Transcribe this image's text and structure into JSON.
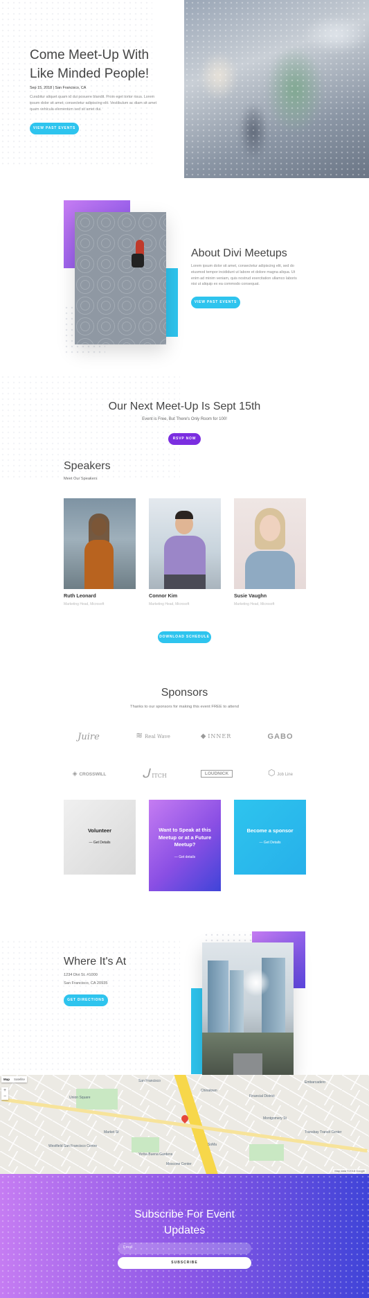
{
  "hero": {
    "title": "Come Meet-Up With Like Minded People!",
    "meta": "Sep 15, 2018 | San Francisco, CA",
    "body": "Curabitur aliquet quam id dui posuere blandit. Proin eget tortor risus. Lorem ipsum dolor sit amet, consectetur adipiscing elit. Vestibulum ac diam sit amet quam vehicula elementum sed sit amet dui.",
    "button": "View Past Events"
  },
  "about": {
    "title": "About Divi Meetups",
    "body": "Lorem ipsum dolor sit amet, consectetur adipiscing elit, sed do eiusmod tempor incididunt ut labore et dolore magna aliqua. Ut enim ad minim veniam, quis nostrud exercitation ullamco laboris nisi ut aliquip ex ea commodo consequat.",
    "button": "View Past Events"
  },
  "next": {
    "title": "Our Next Meet-Up Is Sept 15th",
    "subtitle": "Event is Free, But There's Only Room for 100!",
    "button": "RSVP Now"
  },
  "speakers": {
    "title": "Speakers",
    "subtitle": "Meet Our Speakers",
    "items": [
      {
        "name": "Ruth Leonard",
        "role": "Marketing Head, Microsoft"
      },
      {
        "name": "Connor Kim",
        "role": "Marketing Head, Microsoft"
      },
      {
        "name": "Susie Vaughn",
        "role": "Marketing Head, Microsoft"
      }
    ],
    "button": "Download Schedule"
  },
  "sponsors": {
    "title": "Sponsors",
    "subtitle": "Thanks to our sponsors for making this event FREE to attend",
    "logos": [
      "Juire",
      "Real Wave",
      "INNER",
      "GABO",
      "CROSSWILL",
      "ITCH",
      "LOUDNICK",
      "Job Line"
    ],
    "cards": [
      {
        "title": "Volunteer",
        "link": "— Get Details"
      },
      {
        "title": "Want to Speak at this Meetup or at a Future Meetup?",
        "link": "— Get details"
      },
      {
        "title": "Become a sponsor",
        "link": "— Get Details"
      }
    ]
  },
  "location": {
    "title": "Where It's At",
    "address1": "1234 Divi St. #1000",
    "address2": "San Francisco, CA 20935",
    "button": "Get Directions"
  },
  "map": {
    "tab_map": "Map",
    "tab_satellite": "Satellite",
    "zoom_in": "+",
    "zoom_out": "−",
    "labels": [
      "San Francisco",
      "Union Square",
      "Financial District",
      "SoMa",
      "Embarcadero",
      "Market St",
      "Chinatown",
      "Yerba Buena Gardens",
      "Moscone Center",
      "Montgomery St",
      "Westfield San Francisco Centre",
      "Transbay Transit Center"
    ],
    "attribution": "Map data ©2018 Google"
  },
  "subscribe": {
    "title": "Subscribe For Event Updates",
    "email_placeholder": "Email",
    "button": "Subscribe"
  },
  "colors": {
    "cyan": "#2ec4ee",
    "purple": "#7b2ee0",
    "gradient_start": "#c57cf2",
    "gradient_end": "#3f44d8"
  }
}
